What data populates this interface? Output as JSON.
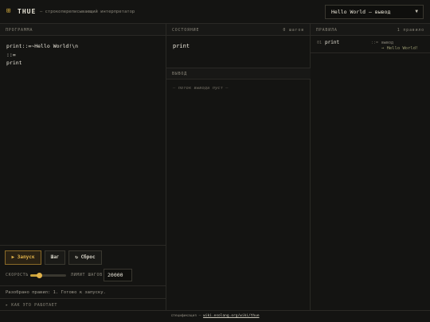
{
  "header": {
    "logo_glyph": "⊞",
    "brand": "THUE",
    "subtitle": "— строкопереписывающий интерпретатор",
    "example_select": "Hello World — вывод"
  },
  "program_panel": {
    "title": "ПРОГРАММА",
    "code_lines": [
      "print::=~Hello World!\\n",
      "::=",
      "print"
    ]
  },
  "state_panel": {
    "title": "СОСТОЯНИЕ",
    "steps": "0 шагов",
    "state_text": "print"
  },
  "output_panel": {
    "title": "ВЫВОД",
    "empty_text": "— поток вывода пуст —"
  },
  "rules_panel": {
    "title": "ПРАВИЛА",
    "count": "1 правило",
    "rules": [
      {
        "num": "01",
        "lhs": "print",
        "op": "::=",
        "kind": "вывод",
        "rhs": "→ Hello World!"
      }
    ]
  },
  "controls": {
    "run_label": "▶ Запуск",
    "step_label": "Шаг",
    "reset_label": "↻ Сброс",
    "speed_label": "СКОРОСТЬ",
    "speed_fraction": 0.25,
    "limit_label": "ЛИМИТ ШАГОВ",
    "limit_value": "20000",
    "status_text": "Разобрано правил: 1. Готово к запуску.",
    "howto_label": "▸ КАК ЭТО РАБОТАЕТ"
  },
  "footer": {
    "prefix": "спецификация — ",
    "link": "wiki.esolang.org/wiki/thue"
  },
  "colors": {
    "background": "#141412",
    "accent": "#c9a23a",
    "border": "#2a2925"
  }
}
